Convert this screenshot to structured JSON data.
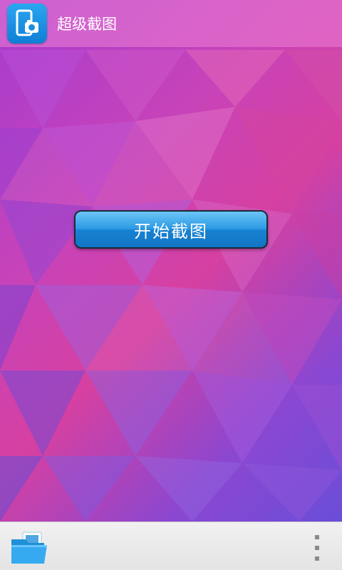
{
  "action_bar": {
    "title": "超级截图",
    "app_icon": "phone-camera-icon",
    "background": "#e980d3"
  },
  "main": {
    "start_button_label": "开始截图",
    "button_color": "#1782d2"
  },
  "bottom_bar": {
    "folder_icon": "folder-icon",
    "overflow_icon": "overflow-menu-icon"
  }
}
